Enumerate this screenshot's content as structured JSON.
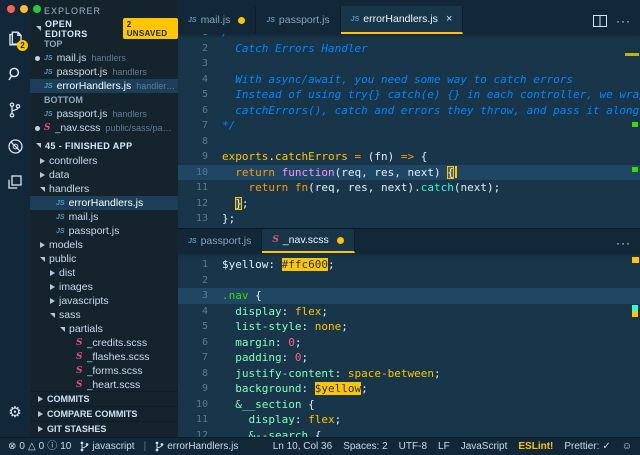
{
  "accent": "#ffc600",
  "traffic_lights": [
    "#ff5f57",
    "#febc2e",
    "#28c840"
  ],
  "activity_bar": {
    "items": [
      {
        "name": "explorer",
        "badge": "2",
        "active": true
      },
      {
        "name": "search"
      },
      {
        "name": "source-control"
      },
      {
        "name": "debug"
      },
      {
        "name": "extensions"
      }
    ]
  },
  "sidebar": {
    "title": "EXPLORER",
    "open_editors": {
      "label": "OPEN EDITORS",
      "badge": "2 UNSAVED",
      "groups": [
        {
          "label": "TOP",
          "items": [
            {
              "icon": "js",
              "label": "mail.js",
              "detail": "handlers",
              "dirty": true
            },
            {
              "icon": "js",
              "label": "passport.js",
              "detail": "handlers"
            },
            {
              "icon": "js",
              "label": "errorHandlers.js",
              "detail": "handler…",
              "selected": true
            }
          ]
        },
        {
          "label": "BOTTOM",
          "items": [
            {
              "icon": "js",
              "label": "passport.js",
              "detail": "handlers"
            },
            {
              "icon": "sass",
              "label": "_nav.scss",
              "detail": "public/sass/pa…",
              "dirty": true
            }
          ]
        }
      ]
    },
    "project": {
      "label": "45 - FINISHED APP",
      "tree": [
        {
          "indent": 0,
          "type": "folder",
          "state": "collapsed",
          "label": "controllers"
        },
        {
          "indent": 0,
          "type": "folder",
          "state": "collapsed",
          "label": "data"
        },
        {
          "indent": 0,
          "type": "folder",
          "state": "expanded",
          "label": "handlers"
        },
        {
          "indent": 1,
          "type": "file",
          "icon": "js",
          "label": "errorHandlers.js",
          "selected": true
        },
        {
          "indent": 1,
          "type": "file",
          "icon": "js",
          "label": "mail.js"
        },
        {
          "indent": 1,
          "type": "file",
          "icon": "js",
          "label": "passport.js"
        },
        {
          "indent": 0,
          "type": "folder",
          "state": "collapsed",
          "label": "models"
        },
        {
          "indent": 0,
          "type": "folder",
          "state": "expanded",
          "label": "public"
        },
        {
          "indent": 1,
          "type": "folder",
          "state": "collapsed",
          "label": "dist"
        },
        {
          "indent": 1,
          "type": "folder",
          "state": "collapsed",
          "label": "images"
        },
        {
          "indent": 1,
          "type": "folder",
          "state": "collapsed",
          "label": "javascripts"
        },
        {
          "indent": 1,
          "type": "folder",
          "state": "expanded",
          "label": "sass"
        },
        {
          "indent": 2,
          "type": "folder",
          "state": "expanded",
          "label": "partials"
        },
        {
          "indent": 3,
          "type": "file",
          "icon": "sass",
          "label": "_credits.scss"
        },
        {
          "indent": 3,
          "type": "file",
          "icon": "sass",
          "label": "_flashes.scss"
        },
        {
          "indent": 3,
          "type": "file",
          "icon": "sass",
          "label": "_forms.scss"
        },
        {
          "indent": 3,
          "type": "file",
          "icon": "sass",
          "label": "_heart.scss"
        },
        {
          "indent": 3,
          "type": "file",
          "icon": "sass",
          "label": "",
          "clipped": true
        }
      ]
    },
    "panels": [
      {
        "label": "COMMITS"
      },
      {
        "label": "COMPARE COMMITS"
      },
      {
        "label": "GIT STASHES"
      }
    ]
  },
  "editor_top": {
    "tabs": [
      {
        "icon": "js",
        "label": "mail.js",
        "dirty": true
      },
      {
        "icon": "js",
        "label": "passport.js"
      },
      {
        "icon": "js",
        "label": "errorHandlers.js",
        "active": true,
        "closable": true
      }
    ],
    "lines": [
      {
        "n": 1,
        "segs": [
          [
            "cm",
            "/*"
          ]
        ]
      },
      {
        "n": 2,
        "segs": [
          [
            "cm",
            "  Catch Errors Handler"
          ]
        ]
      },
      {
        "n": 3,
        "segs": []
      },
      {
        "n": 4,
        "segs": [
          [
            "cm",
            "  With async/await, you need some way to catch errors"
          ]
        ]
      },
      {
        "n": 5,
        "segs": [
          [
            "cm",
            "  Instead of using try{} catch(e) {} in each controller, we wrap th"
          ]
        ]
      },
      {
        "n": 6,
        "segs": [
          [
            "cm",
            "  catchErrors(), catch and errors they throw, and pass it along to "
          ]
        ]
      },
      {
        "n": 7,
        "segs": [
          [
            "cm",
            "*/"
          ]
        ]
      },
      {
        "n": 8,
        "segs": []
      },
      {
        "n": 9,
        "segs": [
          [
            "fnm",
            "exports"
          ],
          [
            "wh",
            "."
          ],
          [
            "fnm",
            "catchErrors"
          ],
          [
            "op",
            " = "
          ],
          [
            "wh",
            "("
          ],
          [
            "wh",
            "fn"
          ],
          [
            "wh",
            ")"
          ],
          [
            "op",
            " => "
          ],
          [
            "wh",
            "{"
          ]
        ]
      },
      {
        "n": 10,
        "cur": true,
        "segs": [
          [
            "wh",
            "  "
          ],
          [
            "kw",
            "return"
          ],
          [
            "wh",
            " "
          ],
          [
            "pink",
            "function"
          ],
          [
            "wh",
            "(req, res, next) "
          ],
          [
            "brkt",
            "{"
          ],
          [
            "cursor",
            ""
          ]
        ]
      },
      {
        "n": 11,
        "segs": [
          [
            "wh",
            "    "
          ],
          [
            "kw",
            "return"
          ],
          [
            "wh",
            " "
          ],
          [
            "kw",
            "fn"
          ],
          [
            "wh",
            "(req, res, next)."
          ],
          [
            "teal",
            "catch"
          ],
          [
            "wh",
            "(next);"
          ]
        ]
      },
      {
        "n": 12,
        "segs": [
          [
            "wh",
            "  "
          ],
          [
            "brkt",
            "}"
          ],
          [
            "wh",
            ";"
          ]
        ]
      },
      {
        "n": 13,
        "segs": [
          [
            "wh",
            "};"
          ]
        ]
      }
    ]
  },
  "editor_bottom": {
    "tabs": [
      {
        "icon": "js",
        "label": "passport.js"
      },
      {
        "icon": "sass",
        "label": "_nav.scss",
        "active": true,
        "dirty": true
      }
    ],
    "lines": [
      {
        "n": 1,
        "segs": [
          [
            "wh",
            "$yellow"
          ],
          [
            "wh",
            ": "
          ],
          [
            "hlY",
            "#ffc600"
          ],
          [
            "wh",
            ";"
          ]
        ]
      },
      {
        "n": 2,
        "segs": []
      },
      {
        "n": 3,
        "cur": true,
        "segs": [
          [
            "sel",
            ".nav"
          ],
          [
            "wh",
            " {"
          ]
        ]
      },
      {
        "n": 4,
        "segs": [
          [
            "wh",
            "  "
          ],
          [
            "prop",
            "display"
          ],
          [
            "wh",
            ": "
          ],
          [
            "val",
            "flex"
          ],
          [
            "wh",
            ";"
          ]
        ]
      },
      {
        "n": 5,
        "segs": [
          [
            "wh",
            "  "
          ],
          [
            "prop",
            "list-style"
          ],
          [
            "wh",
            ": "
          ],
          [
            "val",
            "none"
          ],
          [
            "wh",
            ";"
          ]
        ]
      },
      {
        "n": 6,
        "segs": [
          [
            "wh",
            "  "
          ],
          [
            "prop",
            "margin"
          ],
          [
            "wh",
            ": "
          ],
          [
            "num",
            "0"
          ],
          [
            "wh",
            ";"
          ]
        ]
      },
      {
        "n": 7,
        "segs": [
          [
            "wh",
            "  "
          ],
          [
            "prop",
            "padding"
          ],
          [
            "wh",
            ": "
          ],
          [
            "num",
            "0"
          ],
          [
            "wh",
            ";"
          ]
        ]
      },
      {
        "n": 8,
        "segs": [
          [
            "wh",
            "  "
          ],
          [
            "prop",
            "justify-content"
          ],
          [
            "wh",
            ": "
          ],
          [
            "val",
            "space-between"
          ],
          [
            "wh",
            ";"
          ]
        ]
      },
      {
        "n": 9,
        "segs": [
          [
            "wh",
            "  "
          ],
          [
            "prop",
            "background"
          ],
          [
            "wh",
            ": "
          ],
          [
            "hlY",
            "$yellow"
          ],
          [
            "wh",
            ";"
          ]
        ]
      },
      {
        "n": 10,
        "segs": [
          [
            "wh",
            "  "
          ],
          [
            "sc",
            "&__section"
          ],
          [
            "wh",
            " {"
          ]
        ]
      },
      {
        "n": 11,
        "segs": [
          [
            "wh",
            "    "
          ],
          [
            "prop",
            "display"
          ],
          [
            "wh",
            ": "
          ],
          [
            "val",
            "flex"
          ],
          [
            "wh",
            ";"
          ]
        ]
      },
      {
        "n": 12,
        "segs": [
          [
            "wh",
            "    "
          ],
          [
            "sc",
            "&--search"
          ],
          [
            "wh",
            " {"
          ]
        ]
      }
    ]
  },
  "status_bar": {
    "errors": "0",
    "warnings": "0",
    "infos": "10",
    "branch": "javascript",
    "separator": "|",
    "context_file": "errorHandlers.js",
    "cursor": "Ln 10, Col 36",
    "indent": "Spaces: 2",
    "encoding": "UTF-8",
    "eol": "LF",
    "language": "JavaScript",
    "eslint": "ESLint!",
    "prettier": "Prettier:",
    "prettier_check": "✓",
    "feedback": "☺"
  }
}
